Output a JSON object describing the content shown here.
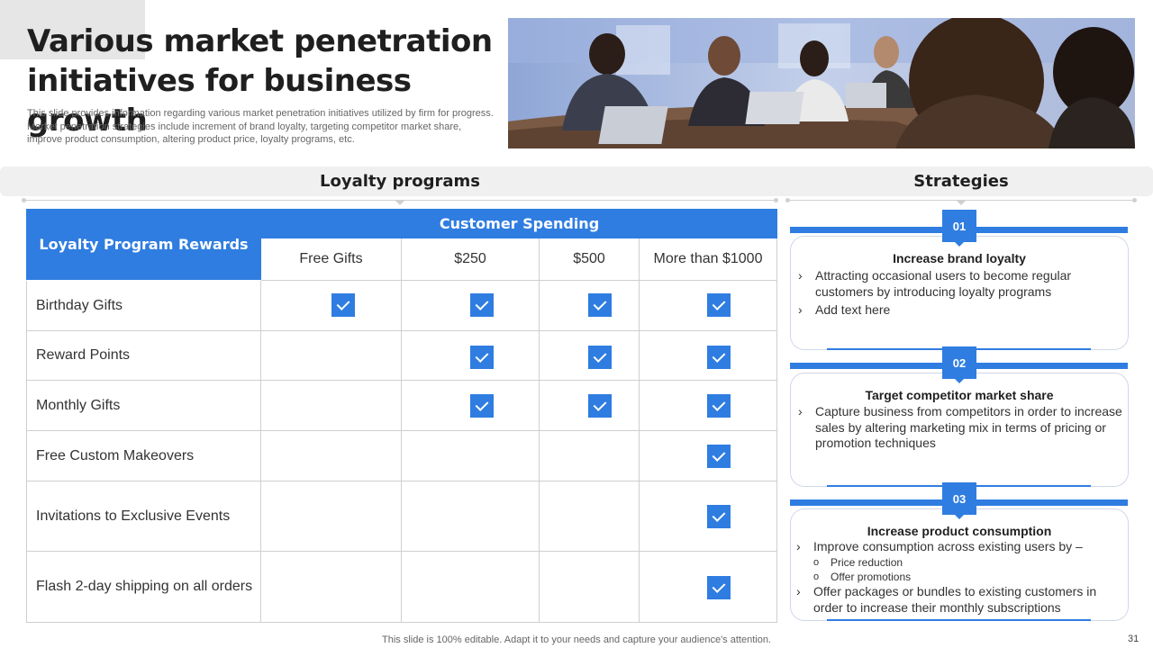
{
  "header": {
    "title_line1": "Various market penetration",
    "title_line2": "initiatives for business growth",
    "subtitle": "This slide provides information regarding various market penetration initiatives utilized by firm for progress. Market penetration strategies include increment of brand loyalty, targeting competitor market share, improve product consumption, altering product price, loyalty programs, etc."
  },
  "sections": {
    "loyalty": "Loyalty programs",
    "strategies": "Strategies"
  },
  "table": {
    "corner_header": "Loyalty Program Rewards",
    "group_header": "Customer Spending",
    "columns": [
      "Free Gifts",
      "$250",
      "$500",
      "More than $1000"
    ],
    "rows": [
      {
        "label": "Birthday Gifts",
        "checks": [
          true,
          true,
          true,
          true
        ]
      },
      {
        "label": "Reward Points",
        "checks": [
          false,
          true,
          true,
          true
        ]
      },
      {
        "label": "Monthly  Gifts",
        "checks": [
          false,
          true,
          true,
          true
        ]
      },
      {
        "label": "Free Custom Makeovers",
        "checks": [
          false,
          false,
          false,
          true
        ]
      },
      {
        "label": "Invitations  to Exclusive  Events",
        "checks": [
          false,
          false,
          false,
          true
        ]
      },
      {
        "label": "Flash 2-day shipping on all orders",
        "checks": [
          false,
          false,
          false,
          true
        ]
      }
    ]
  },
  "strategies": [
    {
      "number": "01",
      "title": "Increase brand loyalty",
      "bullets": [
        "Attracting occasional users to become regular customers by introducing loyalty programs",
        "Add text here"
      ]
    },
    {
      "number": "02",
      "title": "Target competitor market share",
      "bullets": [
        "Capture business from competitors in order to increase sales by altering marketing mix in terms of pricing or promotion techniques"
      ]
    },
    {
      "number": "03",
      "title": "Increase product consumption",
      "bullets": [
        "Improve consumption across existing users by –",
        "Offer packages or bundles to existing customers in order to increase their monthly subscriptions"
      ],
      "subbullets": [
        "Price reduction",
        "Offer  promotions"
      ]
    }
  ],
  "markers": {
    "bullet": "›",
    "sub": "o"
  },
  "footer": {
    "note": "This slide is 100% editable. Adapt it to your needs and capture your audience's attention.",
    "page": "31"
  },
  "colors": {
    "accent": "#2f7de1",
    "band": "#f0f0f0",
    "corner": "#e6e6e6"
  }
}
